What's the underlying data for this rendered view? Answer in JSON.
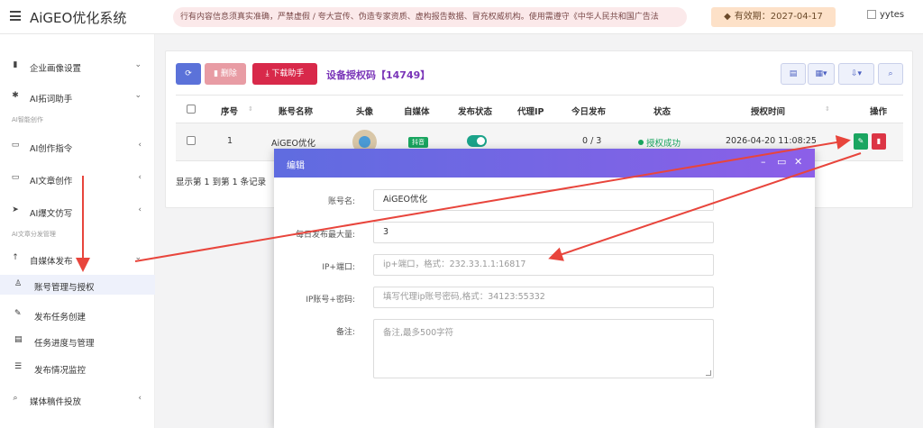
{
  "header": {
    "app_title": "AiGEO优化系统",
    "notice": "行有内容信息须真实准确，严禁虚假 / 夸大宣传、伪造专家资质、虚构报告数据、冒充权威机构。使用需遵守《中华人民共和国广告法",
    "validity": "有效期：2027-04-17",
    "user_name": "yytes"
  },
  "sidebar": {
    "items": [
      {
        "label": "企业画像设置",
        "icon": "book-icon"
      },
      {
        "label": "AI拓词助手",
        "icon": "gear-icon"
      },
      {
        "label": "AI创作指令",
        "icon": "folder-open-icon"
      },
      {
        "label": "AI文章创作",
        "icon": "folder-open-icon"
      },
      {
        "label": "AI爆文仿写",
        "icon": "rocket-icon"
      },
      {
        "label": "自媒体发布",
        "icon": "arrow-up-icon"
      },
      {
        "label": "媒体稿件投放",
        "icon": "search-icon"
      }
    ],
    "sections": [
      "AI智能创作",
      "AI文章分发管理"
    ],
    "children": [
      {
        "label": "账号管理与授权",
        "icon": "user-icon"
      },
      {
        "label": "发布任务创建",
        "icon": "edit-icon"
      },
      {
        "label": "任务进度与管理",
        "icon": "progress-icon"
      },
      {
        "label": "发布情况监控",
        "icon": "list-icon"
      }
    ]
  },
  "toolbar": {
    "refresh_icon": "refresh-icon",
    "delete_label": "删除",
    "download_label": "下载助手",
    "title": "设备授权码【14749】"
  },
  "table": {
    "headers": [
      "序号",
      "账号名称",
      "头像",
      "自媒体",
      "发布状态",
      "代理IP",
      "今日发布",
      "状态",
      "授权时间",
      "操作"
    ],
    "rows": [
      {
        "index": "1",
        "account": "AiGEO优化",
        "platform": "抖音",
        "publish_enabled": true,
        "proxy_ip": "",
        "today": "0 / 3",
        "status": "授权成功",
        "auth_time": "2026-04-20 11:08:25"
      }
    ],
    "footer": "显示第 1 到第 1 条记录"
  },
  "modal": {
    "title": "编辑",
    "fields": {
      "account_label": "账号名:",
      "account_value": "AiGEO优化",
      "max_label": "每日发布最大量:",
      "max_value": "3",
      "ip_label": "IP+端口:",
      "ip_placeholder": "ip+端口，格式：232.33.1.1:16817",
      "cred_label": "IP账号+密码:",
      "cred_placeholder": "填写代理ip账号密码,格式：34123:55332",
      "note_label": "备注:",
      "note_placeholder": "备注,最多500字符"
    }
  },
  "colors": {
    "accent": "#5b72d9",
    "danger": "#d8294a",
    "success": "#1aa560",
    "title_purple": "#7a35b8",
    "arrow_red": "#e8453c"
  }
}
